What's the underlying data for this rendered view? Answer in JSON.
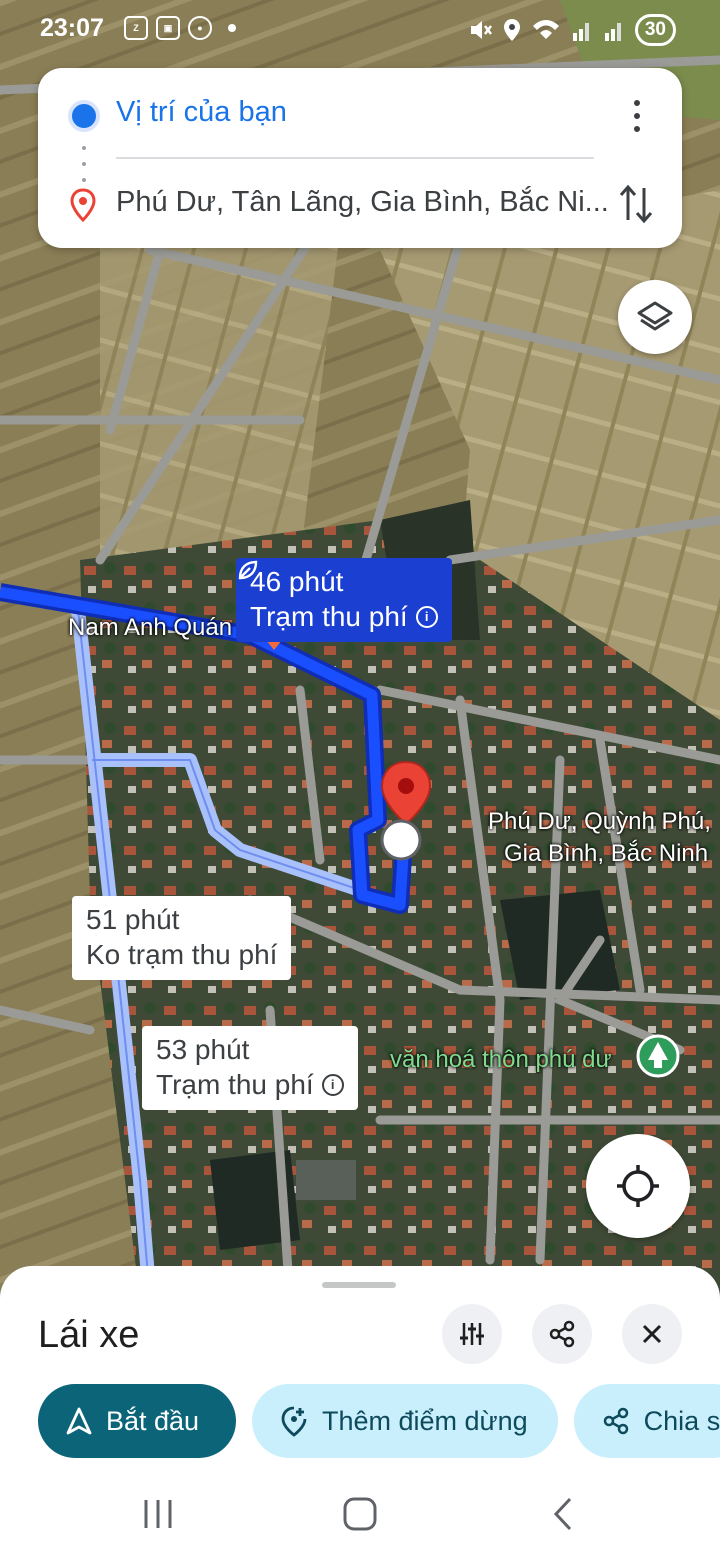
{
  "status_bar": {
    "time": "23:07",
    "left_icons": [
      "zalo-icon",
      "scan-icon",
      "football-icon",
      "dot-icon"
    ],
    "right_icons": [
      "mute-icon",
      "location-icon",
      "wifi-icon",
      "signal-icon",
      "signal-icon-2"
    ],
    "battery": "30"
  },
  "search": {
    "origin": "Vị trí của bạn",
    "destination": "Phú Dư, Tân Lãng, Gia Bình, Bắc Ni..."
  },
  "routes": [
    {
      "time": "46 phút",
      "note": "Trạm thu phí",
      "selected": true,
      "eco": true,
      "info": true
    },
    {
      "time": "51 phút",
      "note": "Ko trạm thu phí",
      "selected": false,
      "info": false
    },
    {
      "time": "53 phút",
      "note": "Trạm thu phí",
      "selected": false,
      "info": true
    }
  ],
  "map_labels": {
    "poi_1": "Nam Anh Quán",
    "destination_line1": "Phú Dư, Quỳnh Phú,",
    "destination_line2": "Gia Bình, Bắc Ninh",
    "poi_2": "văn hoá thôn phú dư"
  },
  "sheet": {
    "title": "Lái xe",
    "start_label": "Bắt đầu",
    "add_stop_label": "Thêm điểm dừng",
    "share_label": "Chia s"
  },
  "colors": {
    "route_primary": "#1a3fd1",
    "route_alt": "#a9c1fb",
    "accent": "#1a73e8",
    "start_button": "#0b6478",
    "chip_light": "#c9eefc",
    "pin": "#ea4335"
  }
}
